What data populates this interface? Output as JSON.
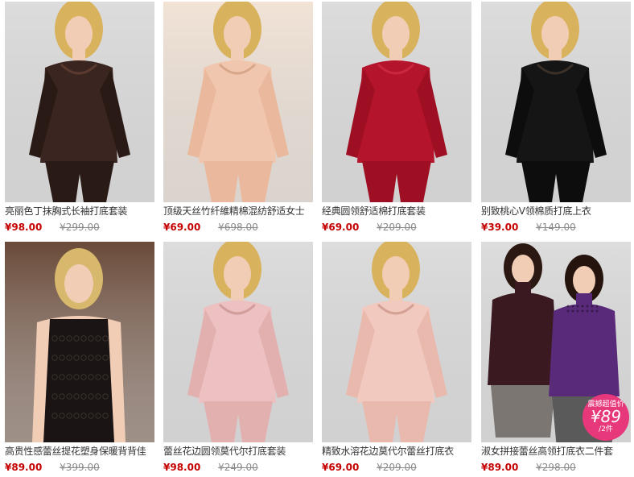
{
  "products": [
    {
      "title": "亮丽色丁抹胸式长袖打底套装",
      "price": "¥98.00",
      "original_price": "¥299.00",
      "icon": "product-photo-brown-lace-set",
      "bg": "#dcdcdc",
      "garment": "#3a2520",
      "garment2": "#2a1a16",
      "accent": "#5b3b2f"
    },
    {
      "title": "顶级天丝竹纤維精棉混纺舒适女士",
      "price": "¥69.00",
      "original_price": "¥698.00",
      "icon": "product-photo-nude-set",
      "bg": "#f2e3d6",
      "garment": "#f0c7ae",
      "garment2": "#eab99d",
      "accent": "#d8a789"
    },
    {
      "title": "经典圆领舒适棉打底套装",
      "price": "¥69.00",
      "original_price": "¥209.00",
      "icon": "product-photo-red-set",
      "bg": "#dcdcdc",
      "garment": "#b4142c",
      "garment2": "#9e0f24",
      "accent": "#c92740"
    },
    {
      "title": "别致桃心V领棉质打底上衣",
      "price": "¥39.00",
      "original_price": "¥149.00",
      "icon": "product-photo-black-top",
      "bg": "#dcdcdc",
      "garment": "#151515",
      "garment2": "#0d0d0d",
      "accent": "#3a3028"
    },
    {
      "title": "高贵性感蕾丝提花塑身保暖背背佳",
      "price": "¥89.00",
      "original_price": "¥399.00",
      "icon": "product-photo-black-lace-vest",
      "bg": "#6a4a38",
      "garment": "#1a1414",
      "garment2": "#0f0b0b",
      "accent": "#3b302c"
    },
    {
      "title": "蕾丝花边圆领莫代尔打底套装",
      "price": "¥98.00",
      "original_price": "¥249.00",
      "icon": "product-photo-pink-set",
      "bg": "#dcdcdc",
      "garment": "#edc1c1",
      "garment2": "#e3b0b0",
      "accent": "#d49d9d"
    },
    {
      "title": "精致水溶花边莫代尔蕾丝打底衣",
      "price": "¥69.00",
      "original_price": "¥209.00",
      "icon": "product-photo-pink-lace-top",
      "bg": "#dcdcdc",
      "garment": "#f1c9bf",
      "garment2": "#e9b9ad",
      "accent": "#d4a195"
    },
    {
      "title": "淑女拼接蕾丝高领打底衣二件套",
      "price": "¥89.00",
      "original_price": "¥298.00",
      "icon": "product-photo-two-models-turtleneck",
      "bg": "#dcdcdc",
      "garment": "#3a1a20",
      "garment2": "#5a2a7a",
      "accent": "#6c6c6c",
      "promo": {
        "top": "震撼超值价",
        "price": "¥89",
        "unit": "/2件"
      }
    }
  ]
}
